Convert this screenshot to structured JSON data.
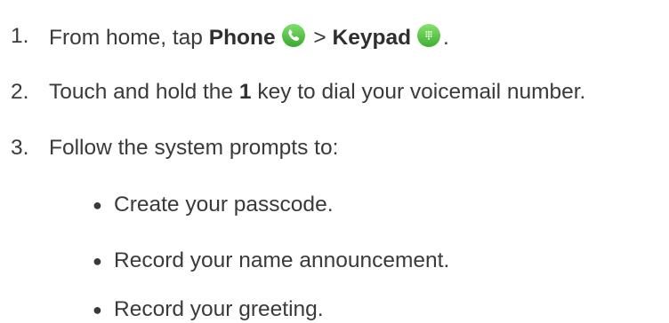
{
  "steps": [
    {
      "num": "1.",
      "prefix": "From home, tap ",
      "phone": "Phone",
      "sep": " > ",
      "keypad": "Keypad",
      "suffix": "."
    },
    {
      "num": "2.",
      "prefix": "Touch and hold the ",
      "key": "1",
      "suffix": " key to dial your voicemail number."
    },
    {
      "num": "3.",
      "text": "Follow the system prompts to:"
    }
  ],
  "sub_items": [
    "Create your passcode.",
    "Record your name announcement.",
    "Record your greeting."
  ],
  "icons": {
    "phone": "phone-app-icon",
    "keypad": "keypad-icon"
  },
  "colors": {
    "text": "#3a3a3a",
    "icon_green": "#5bc94a"
  }
}
